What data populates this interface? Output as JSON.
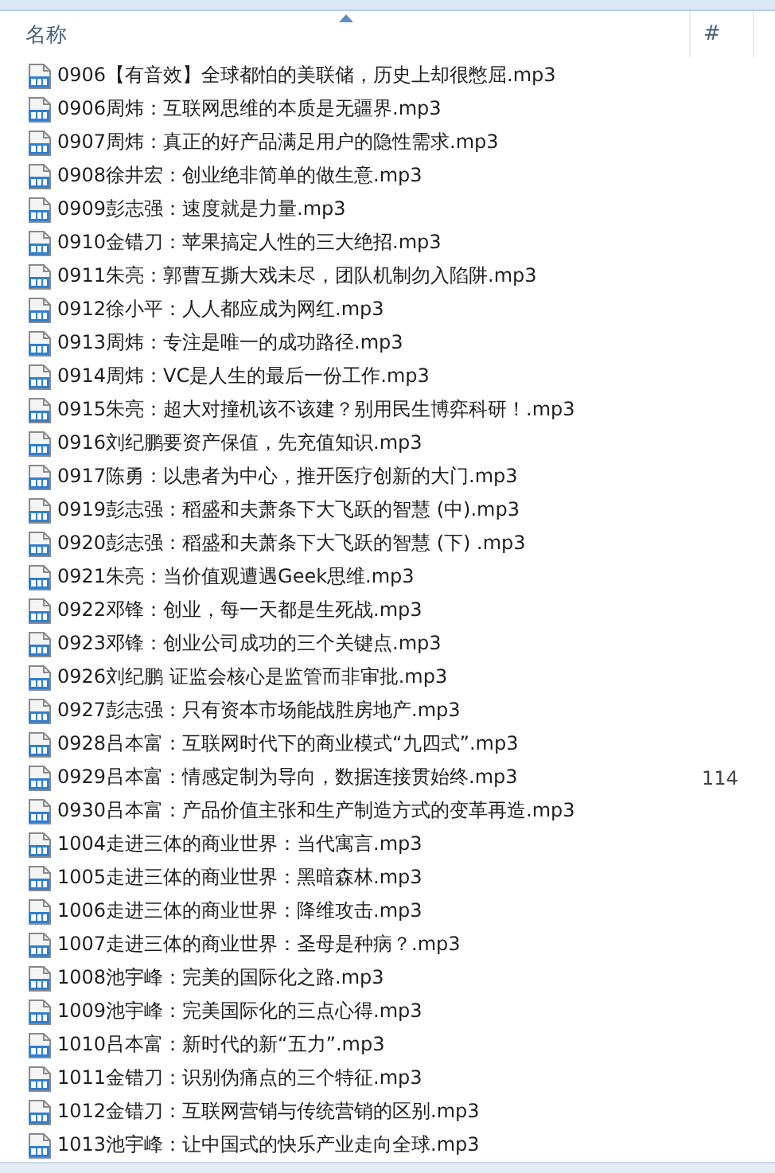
{
  "columns": [
    {
      "kind": "name",
      "label": "名称",
      "sorted": true
    },
    {
      "kind": "number",
      "label": "#",
      "sorted": false
    }
  ],
  "files": [
    {
      "name": "0906【有音效】全球都怕的美联储，历史上却很憋屈.mp3"
    },
    {
      "name": "0906周炜：互联网思维的本质是无疆界.mp3"
    },
    {
      "name": "0907周炜：真正的好产品满足用户的隐性需求.mp3"
    },
    {
      "name": "0908徐井宏：创业绝非简单的做生意.mp3"
    },
    {
      "name": "0909彭志强：速度就是力量.mp3"
    },
    {
      "name": "0910金错刀：苹果搞定人性的三大绝招.mp3"
    },
    {
      "name": "0911朱亮：郭曹互撕大戏未尽，团队机制勿入陷阱.mp3"
    },
    {
      "name": "0912徐小平：人人都应成为网红.mp3"
    },
    {
      "name": "0913周炜：专注是唯一的成功路径.mp3"
    },
    {
      "name": "0914周炜：VC是人生的最后一份工作.mp3"
    },
    {
      "name": "0915朱亮：超大对撞机该不该建？别用民生博弈科研！.mp3"
    },
    {
      "name": "0916刘纪鹏要资产保值，先充值知识.mp3"
    },
    {
      "name": "0917陈勇：以患者为中心，推开医疗创新的大门.mp3"
    },
    {
      "name": "0919彭志强：稻盛和夫萧条下大飞跃的智慧 (中).mp3"
    },
    {
      "name": "0920彭志强：稻盛和夫萧条下大飞跃的智慧 (下) .mp3"
    },
    {
      "name": "0921朱亮：当价值观遭遇Geek思维.mp3"
    },
    {
      "name": "0922邓锋：创业，每一天都是生死战.mp3"
    },
    {
      "name": "0923邓锋：创业公司成功的三个关键点.mp3"
    },
    {
      "name": "0926刘纪鹏 证监会核心是监管而非审批.mp3"
    },
    {
      "name": "0927彭志强：只有资本市场能战胜房地产.mp3"
    },
    {
      "name": "0928吕本富：互联网时代下的商业模式“九四式”.mp3"
    },
    {
      "name": "0929吕本富：情感定制为导向，数据连接贯始终.mp3",
      "number": "114"
    },
    {
      "name": "0930吕本富：产品价值主张和生产制造方式的变革再造.mp3"
    },
    {
      "name": "1004走进三体的商业世界：当代寓言.mp3"
    },
    {
      "name": "1005走进三体的商业世界：黑暗森林.mp3"
    },
    {
      "name": "1006走进三体的商业世界：降维攻击.mp3"
    },
    {
      "name": "1007走进三体的商业世界：圣母是种病？.mp3"
    },
    {
      "name": "1008池宇峰：完美的国际化之路.mp3"
    },
    {
      "name": "1009池宇峰：完美国际化的三点心得.mp3"
    },
    {
      "name": "1010吕本富：新时代的新“五力”.mp3"
    },
    {
      "name": "1011金错刀：识别伪痛点的三个特征.mp3"
    },
    {
      "name": "1012金错刀：互联网营销与传统营销的区别.mp3"
    },
    {
      "name": "1013池宇峰：让中国式的快乐产业走向全球.mp3"
    }
  ]
}
